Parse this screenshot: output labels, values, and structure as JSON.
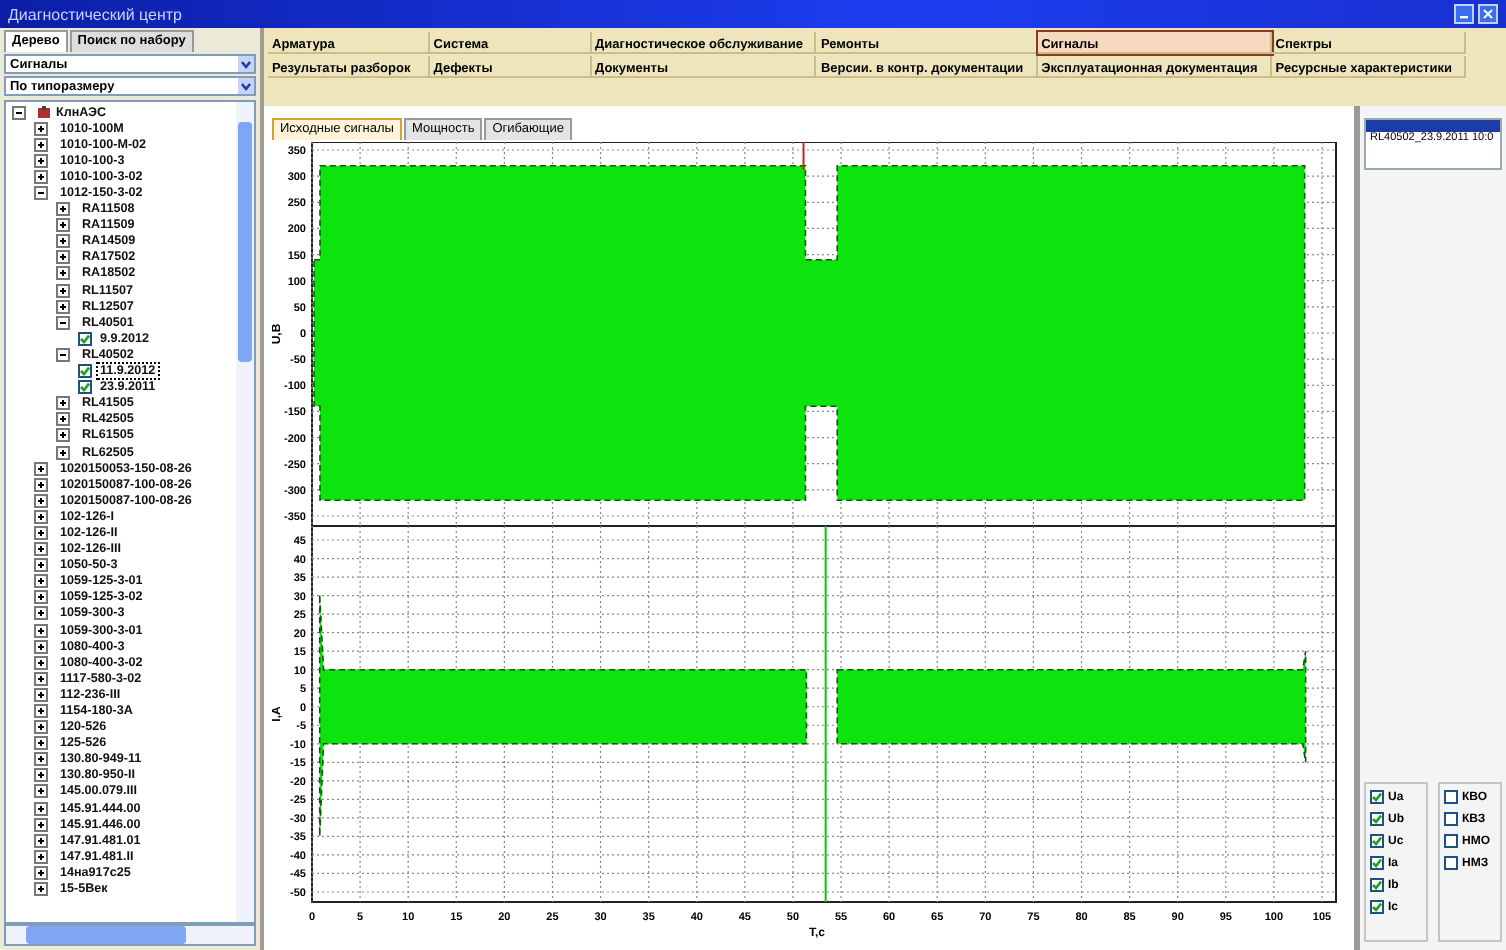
{
  "window": {
    "title": "Диагностический центр"
  },
  "left_tabs": [
    {
      "label": "Дерево",
      "selected": true
    },
    {
      "label": "Поиск по набору",
      "selected": false
    }
  ],
  "filters": [
    {
      "value": "Сигналы"
    },
    {
      "value": "По типоразмеру"
    }
  ],
  "tree": [
    {
      "kind": "node",
      "label": "КлнАЭС",
      "expanded": true,
      "children": [
        {
          "kind": "node",
          "label": "1010-100М",
          "expanded": false
        },
        {
          "kind": "node",
          "label": "1010-100-М-02",
          "expanded": false
        },
        {
          "kind": "node",
          "label": "1010-100-3",
          "expanded": false
        },
        {
          "kind": "node",
          "label": "1010-100-3-02",
          "expanded": false
        },
        {
          "kind": "node",
          "label": "1012-150-3-02",
          "expanded": true,
          "children": [
            {
              "kind": "node",
              "label": "RA11508",
              "expanded": false
            },
            {
              "kind": "node",
              "label": "RA11509",
              "expanded": false
            },
            {
              "kind": "node",
              "label": "RA14509",
              "expanded": false
            },
            {
              "kind": "node",
              "label": "RA17502",
              "expanded": false
            },
            {
              "kind": "node",
              "label": "RA18502",
              "expanded": false
            },
            {
              "kind": "node",
              "label": "RL11507",
              "expanded": false
            },
            {
              "kind": "node",
              "label": "RL12507",
              "expanded": false
            },
            {
              "kind": "node",
              "label": "RL40501",
              "expanded": true,
              "children": [
                {
                  "kind": "record",
                  "label": "9.9.2012",
                  "checked": true,
                  "selected": false
                }
              ]
            },
            {
              "kind": "node",
              "label": "RL40502",
              "expanded": true,
              "children": [
                {
                  "kind": "record",
                  "label": "11.9.2012",
                  "checked": true,
                  "selected": true
                },
                {
                  "kind": "record",
                  "label": "23.9.2011",
                  "checked": true,
                  "selected": false
                }
              ]
            },
            {
              "kind": "node",
              "label": "RL41505",
              "expanded": false
            },
            {
              "kind": "node",
              "label": "RL42505",
              "expanded": false
            },
            {
              "kind": "node",
              "label": "RL61505",
              "expanded": false
            },
            {
              "kind": "node",
              "label": "RL62505",
              "expanded": false
            }
          ]
        },
        {
          "kind": "node",
          "label": "1020150053-150-08-26",
          "expanded": false
        },
        {
          "kind": "node",
          "label": "1020150087-100-08-26",
          "expanded": false
        },
        {
          "kind": "node",
          "label": "1020150087-100-08-26",
          "expanded": false
        },
        {
          "kind": "node",
          "label": "102-126-I",
          "expanded": false
        },
        {
          "kind": "node",
          "label": "102-126-II",
          "expanded": false
        },
        {
          "kind": "node",
          "label": "102-126-III",
          "expanded": false
        },
        {
          "kind": "node",
          "label": "1050-50-3",
          "expanded": false
        },
        {
          "kind": "node",
          "label": "1059-125-3-01",
          "expanded": false
        },
        {
          "kind": "node",
          "label": "1059-125-3-02",
          "expanded": false
        },
        {
          "kind": "node",
          "label": "1059-300-3",
          "expanded": false
        },
        {
          "kind": "node",
          "label": "1059-300-3-01",
          "expanded": false
        },
        {
          "kind": "node",
          "label": "1080-400-3",
          "expanded": false
        },
        {
          "kind": "node",
          "label": "1080-400-3-02",
          "expanded": false
        },
        {
          "kind": "node",
          "label": "1117-580-3-02",
          "expanded": false
        },
        {
          "kind": "node",
          "label": "112-236-III",
          "expanded": false
        },
        {
          "kind": "node",
          "label": "1154-180-3А",
          "expanded": false
        },
        {
          "kind": "node",
          "label": "120-526",
          "expanded": false
        },
        {
          "kind": "node",
          "label": "125-526",
          "expanded": false
        },
        {
          "kind": "node",
          "label": "130.80-949-11",
          "expanded": false
        },
        {
          "kind": "node",
          "label": "130.80-950-II",
          "expanded": false
        },
        {
          "kind": "node",
          "label": "145.00.079.III",
          "expanded": false
        },
        {
          "kind": "node",
          "label": "145.91.444.00",
          "expanded": false
        },
        {
          "kind": "node",
          "label": "145.91.446.00",
          "expanded": false
        },
        {
          "kind": "node",
          "label": "147.91.481.01",
          "expanded": false
        },
        {
          "kind": "node",
          "label": "147.91.481.II",
          "expanded": false
        },
        {
          "kind": "node",
          "label": "14на917с25",
          "expanded": false
        },
        {
          "kind": "node",
          "label": "15-5Век",
          "expanded": false
        }
      ]
    }
  ],
  "menu": [
    {
      "label": "Арматура",
      "selected": false
    },
    {
      "label": "Система",
      "selected": false
    },
    {
      "label": "Диагностическое обслуживание",
      "selected": false
    },
    {
      "label": "Ремонты",
      "selected": false
    },
    {
      "label": "Сигналы",
      "selected": true
    },
    {
      "label": "Спектры",
      "selected": false
    },
    {
      "label": "Результаты разборок",
      "selected": false
    },
    {
      "label": "Дефекты",
      "selected": false
    },
    {
      "label": "Документы",
      "selected": false
    },
    {
      "label": "Версии. в контр. документации",
      "selected": false
    },
    {
      "label": "Эксплуатационная документация",
      "selected": false
    },
    {
      "label": "Ресурсные характеристики",
      "selected": false
    }
  ],
  "signal_tabs": [
    {
      "label": "Исходные сигналы",
      "selected": true
    },
    {
      "label": "Мощность",
      "selected": false
    },
    {
      "label": "Огибающие",
      "selected": false
    }
  ],
  "plots": [
    {
      "ylabel": "U,В",
      "yticks": [
        "350",
        "300",
        "250",
        "200",
        "150",
        "100",
        "50",
        "0",
        "-50",
        "-100",
        "-150",
        "-200",
        "-250",
        "-300",
        "-350"
      ]
    },
    {
      "ylabel": "I,А",
      "yticks": [
        "45",
        "40",
        "35",
        "30",
        "25",
        "20",
        "15",
        "10",
        "5",
        "0",
        "-5",
        "-10",
        "-15",
        "-20",
        "-25",
        "-30",
        "-35",
        "-40",
        "-45",
        "-50"
      ]
    }
  ],
  "x_axis": {
    "label": "T,c",
    "ticks": [
      "0",
      "5",
      "10",
      "15",
      "20",
      "25",
      "30",
      "35",
      "40",
      "45",
      "50",
      "55",
      "60",
      "65",
      "70",
      "75",
      "80",
      "85",
      "90",
      "95",
      "100",
      "105"
    ]
  },
  "records": [
    {
      "label": "RL40502_23.9.2011 10:0",
      "selected": false
    }
  ],
  "phase_checks": [
    {
      "label": "Ua",
      "checked": true
    },
    {
      "label": "Ub",
      "checked": true
    },
    {
      "label": "Uc",
      "checked": true
    },
    {
      "label": "Ia",
      "checked": true
    },
    {
      "label": "Ib",
      "checked": true
    },
    {
      "label": "Ic",
      "checked": true
    }
  ],
  "extra_checks": [
    {
      "label": "КВО",
      "checked": false
    },
    {
      "label": "КВЗ",
      "checked": false
    },
    {
      "label": "НМО",
      "checked": false
    },
    {
      "label": "НМЗ",
      "checked": false
    }
  ]
}
